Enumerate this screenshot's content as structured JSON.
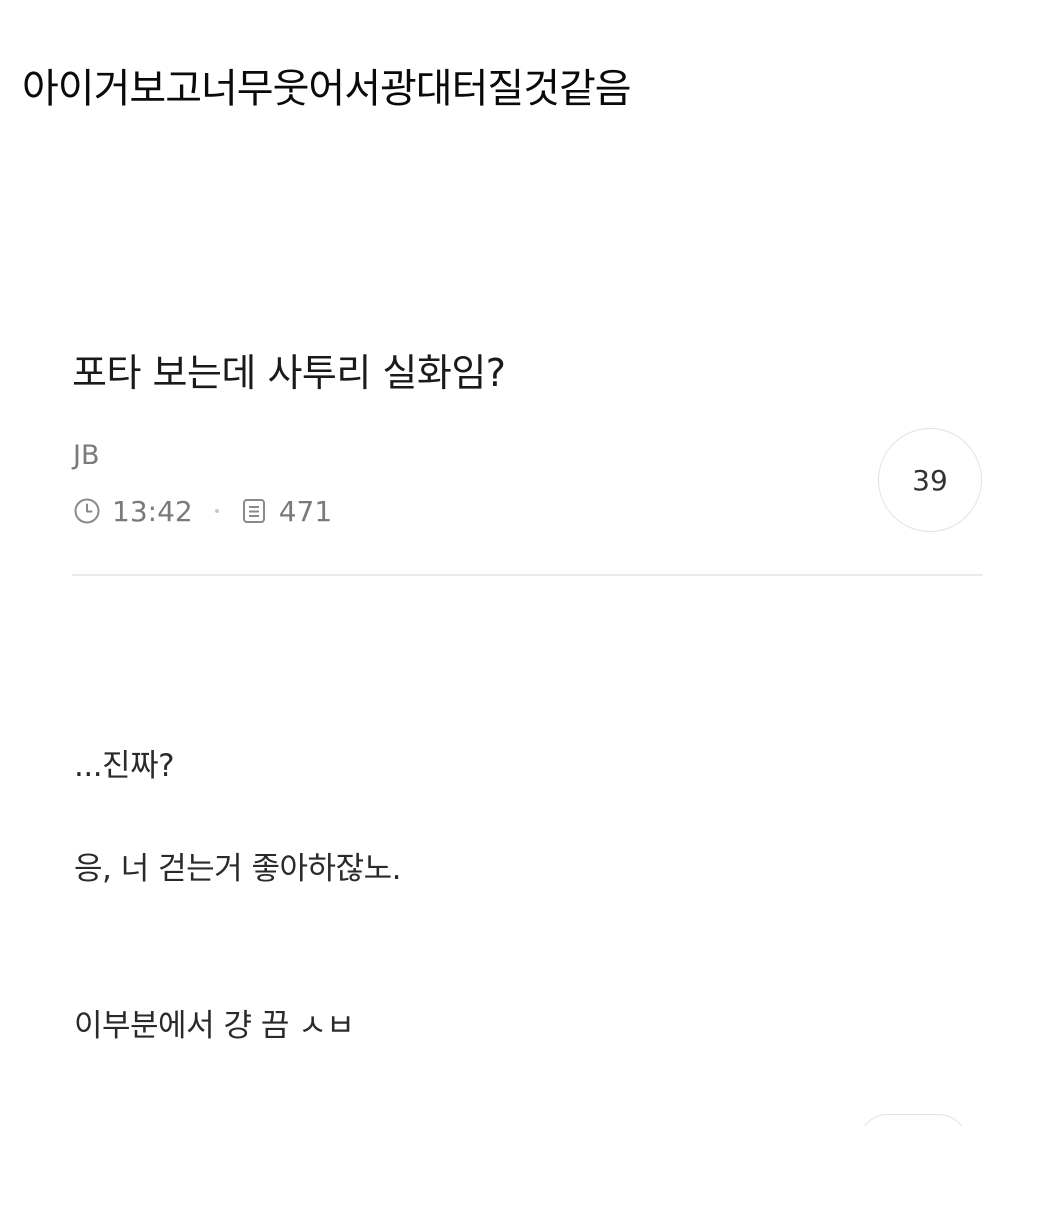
{
  "caption": "아이거보고너무웃어서광대터질것같음",
  "post": {
    "title": "포타 보는데 사투리 실화임?",
    "author": "JB",
    "time": "13:42",
    "time_icon": "clock-icon",
    "views": "471",
    "views_icon": "document-icon",
    "comment_count": "39"
  },
  "body": {
    "line1": "...진짜?",
    "line2": "응, 너 걷는거 좋아하잖노.",
    "line3": "이부분에서 걍 끔 ㅅㅂ"
  },
  "colors": {
    "meta_gray": "#7a7a7a",
    "divider": "#ebebeb",
    "circle_border": "#e3e3e3"
  }
}
